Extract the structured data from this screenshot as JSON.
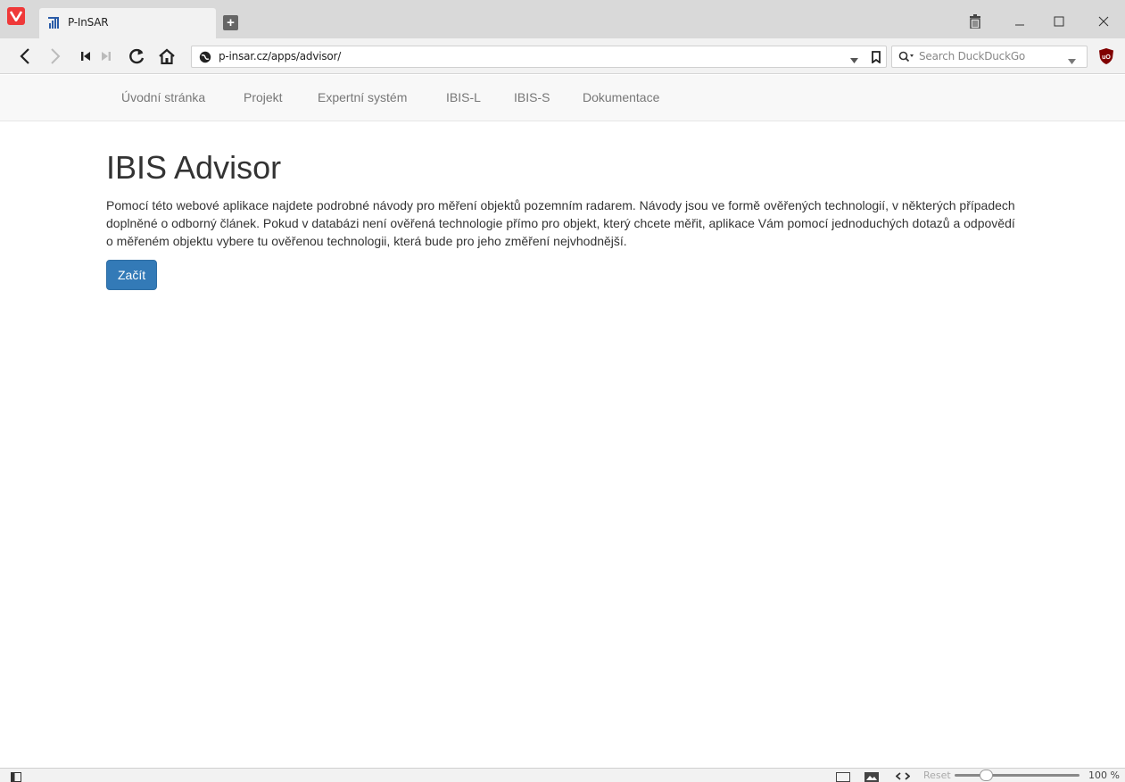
{
  "browser": {
    "tab_title": "P-InSAR",
    "url": "p-insar.cz/apps/advisor/",
    "search_placeholder": "Search DuckDuckGo",
    "zoom_reset_label": "Reset",
    "zoom_level": "100 %",
    "icons": [
      "vivaldi-logo-icon",
      "favicon-icon",
      "new-tab-icon",
      "trash-icon",
      "minimize-icon",
      "maximize-icon",
      "close-icon",
      "back-icon",
      "forward-icon",
      "rewind-icon",
      "fast-forward-icon",
      "reload-icon",
      "home-icon",
      "site-info-icon",
      "dropdown-icon",
      "bookmark-icon",
      "search-engine-icon",
      "ublock-icon",
      "panel-toggle-icon",
      "page-tiling-icon",
      "images-icon",
      "page-actions-icon"
    ],
    "accent_color": "#ef3939"
  },
  "site_nav": {
    "items": [
      "Úvodní stránka",
      "Projekt",
      "Expertní systém",
      "IBIS-L",
      "IBIS-S",
      "Dokumentace"
    ]
  },
  "main": {
    "title": "IBIS Advisor",
    "intro": "Pomocí této webové aplikace najdete podrobné návody pro měření objektů pozemním radarem. Návody jsou ve formě ověřených technologií, v některých případech doplněné o odborný článek. Pokud v databázi není ověřená technologie přímo pro objekt, který chcete měřit, aplikace Vám pomocí jednoduchých dotazů a odpovědí o měřeném objektu vybere tu ověřenou technologii, která bude pro jeho změření nejvhodnější.",
    "start_button": "Začít",
    "button_color": "#337ab7"
  }
}
